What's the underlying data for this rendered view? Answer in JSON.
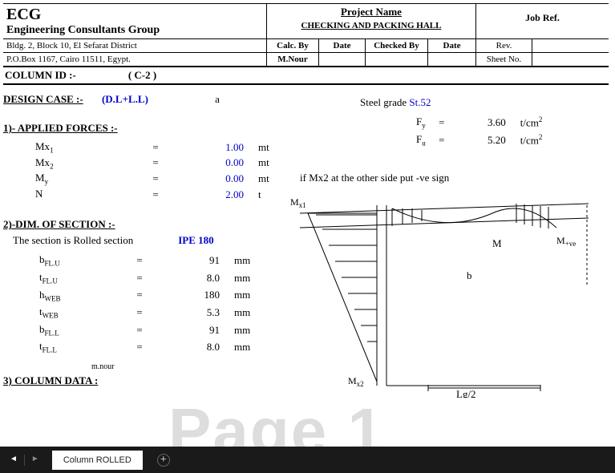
{
  "company": {
    "name": "ECG",
    "subtitle": "Engineering Consultants Group",
    "addr1": "Bldg. 2, Block 10, El Sefarat District",
    "addr2": "P.O.Box 1167, Cairo 11511, Egypt."
  },
  "project": {
    "label": "Project Name",
    "value": "CHECKING AND PACKING HALL"
  },
  "jobref": {
    "label": "Job Ref."
  },
  "info": {
    "calcby_label": "Calc. By",
    "calcby": "M.Nour",
    "date_label": "Date",
    "checkedby_label": "Checked By",
    "date2_label": "Date",
    "rev_label": "Rev.",
    "sheet_label": "Sheet No."
  },
  "column": {
    "label": "COLUMN ID :-",
    "value": "( C-2 )"
  },
  "design": {
    "label": "DESIGN CASE :-",
    "value": "(D.L+L.L)",
    "letter": "a"
  },
  "steel": {
    "label": "Steel grade",
    "grade": "St.52"
  },
  "props": {
    "fy": {
      "sym": "F",
      "sub": "y",
      "eq": "=",
      "val": "3.60",
      "unit": "t/cm",
      "sup": "2"
    },
    "fu": {
      "sym": "F",
      "sub": "u",
      "eq": "=",
      "val": "5.20",
      "unit": "t/cm",
      "sup": "2"
    }
  },
  "section1": "1)- APPLIED FORCES :-",
  "forces": [
    {
      "sym": "Mx",
      "sub": "1",
      "eq": "=",
      "val": "1.00",
      "unit": "mt"
    },
    {
      "sym": "Mx",
      "sub": "2",
      "eq": "=",
      "val": "0.00",
      "unit": "mt"
    },
    {
      "sym": "M",
      "sub": "y",
      "eq": "=",
      "val": "0.00",
      "unit": "mt"
    },
    {
      "sym": "N",
      "sub": "",
      "eq": "=",
      "val": "2.00",
      "unit": "t"
    }
  ],
  "mx2note": "if Mx2 at the other side put -ve sign",
  "section2": "2)-DIM. OF SECTION :-",
  "section_is": "The section is Rolled section",
  "ipe": "IPE 180",
  "dims": [
    {
      "sym": "b",
      "sub": "FL.U",
      "eq": "=",
      "val": "91",
      "unit": "mm"
    },
    {
      "sym": "t",
      "sub": "FL.U",
      "eq": "=",
      "val": "8.0",
      "unit": "mm"
    },
    {
      "sym": "h",
      "sub": "WEB",
      "eq": "=",
      "val": "180",
      "unit": "mm"
    },
    {
      "sym": "t",
      "sub": "WEB",
      "eq": "=",
      "val": "5.3",
      "unit": "mm"
    },
    {
      "sym": "b",
      "sub": "FL.L",
      "eq": "=",
      "val": "91",
      "unit": "mm"
    },
    {
      "sym": "t",
      "sub": "FL.L",
      "eq": "=",
      "val": "8.0",
      "unit": "mm"
    }
  ],
  "author": "m.nour",
  "section3": "3) COLUMN DATA :",
  "watermark": "Page 1",
  "diagram": {
    "mx1": "M",
    "mx1sub": "x1",
    "mx2": "M",
    "mx2sub": "x2",
    "m": "M",
    "mtve": "M",
    "mtvesub": "+ve",
    "b": "b",
    "lg2": "Lg/2"
  },
  "tab": {
    "label": "Column ROLLED"
  }
}
